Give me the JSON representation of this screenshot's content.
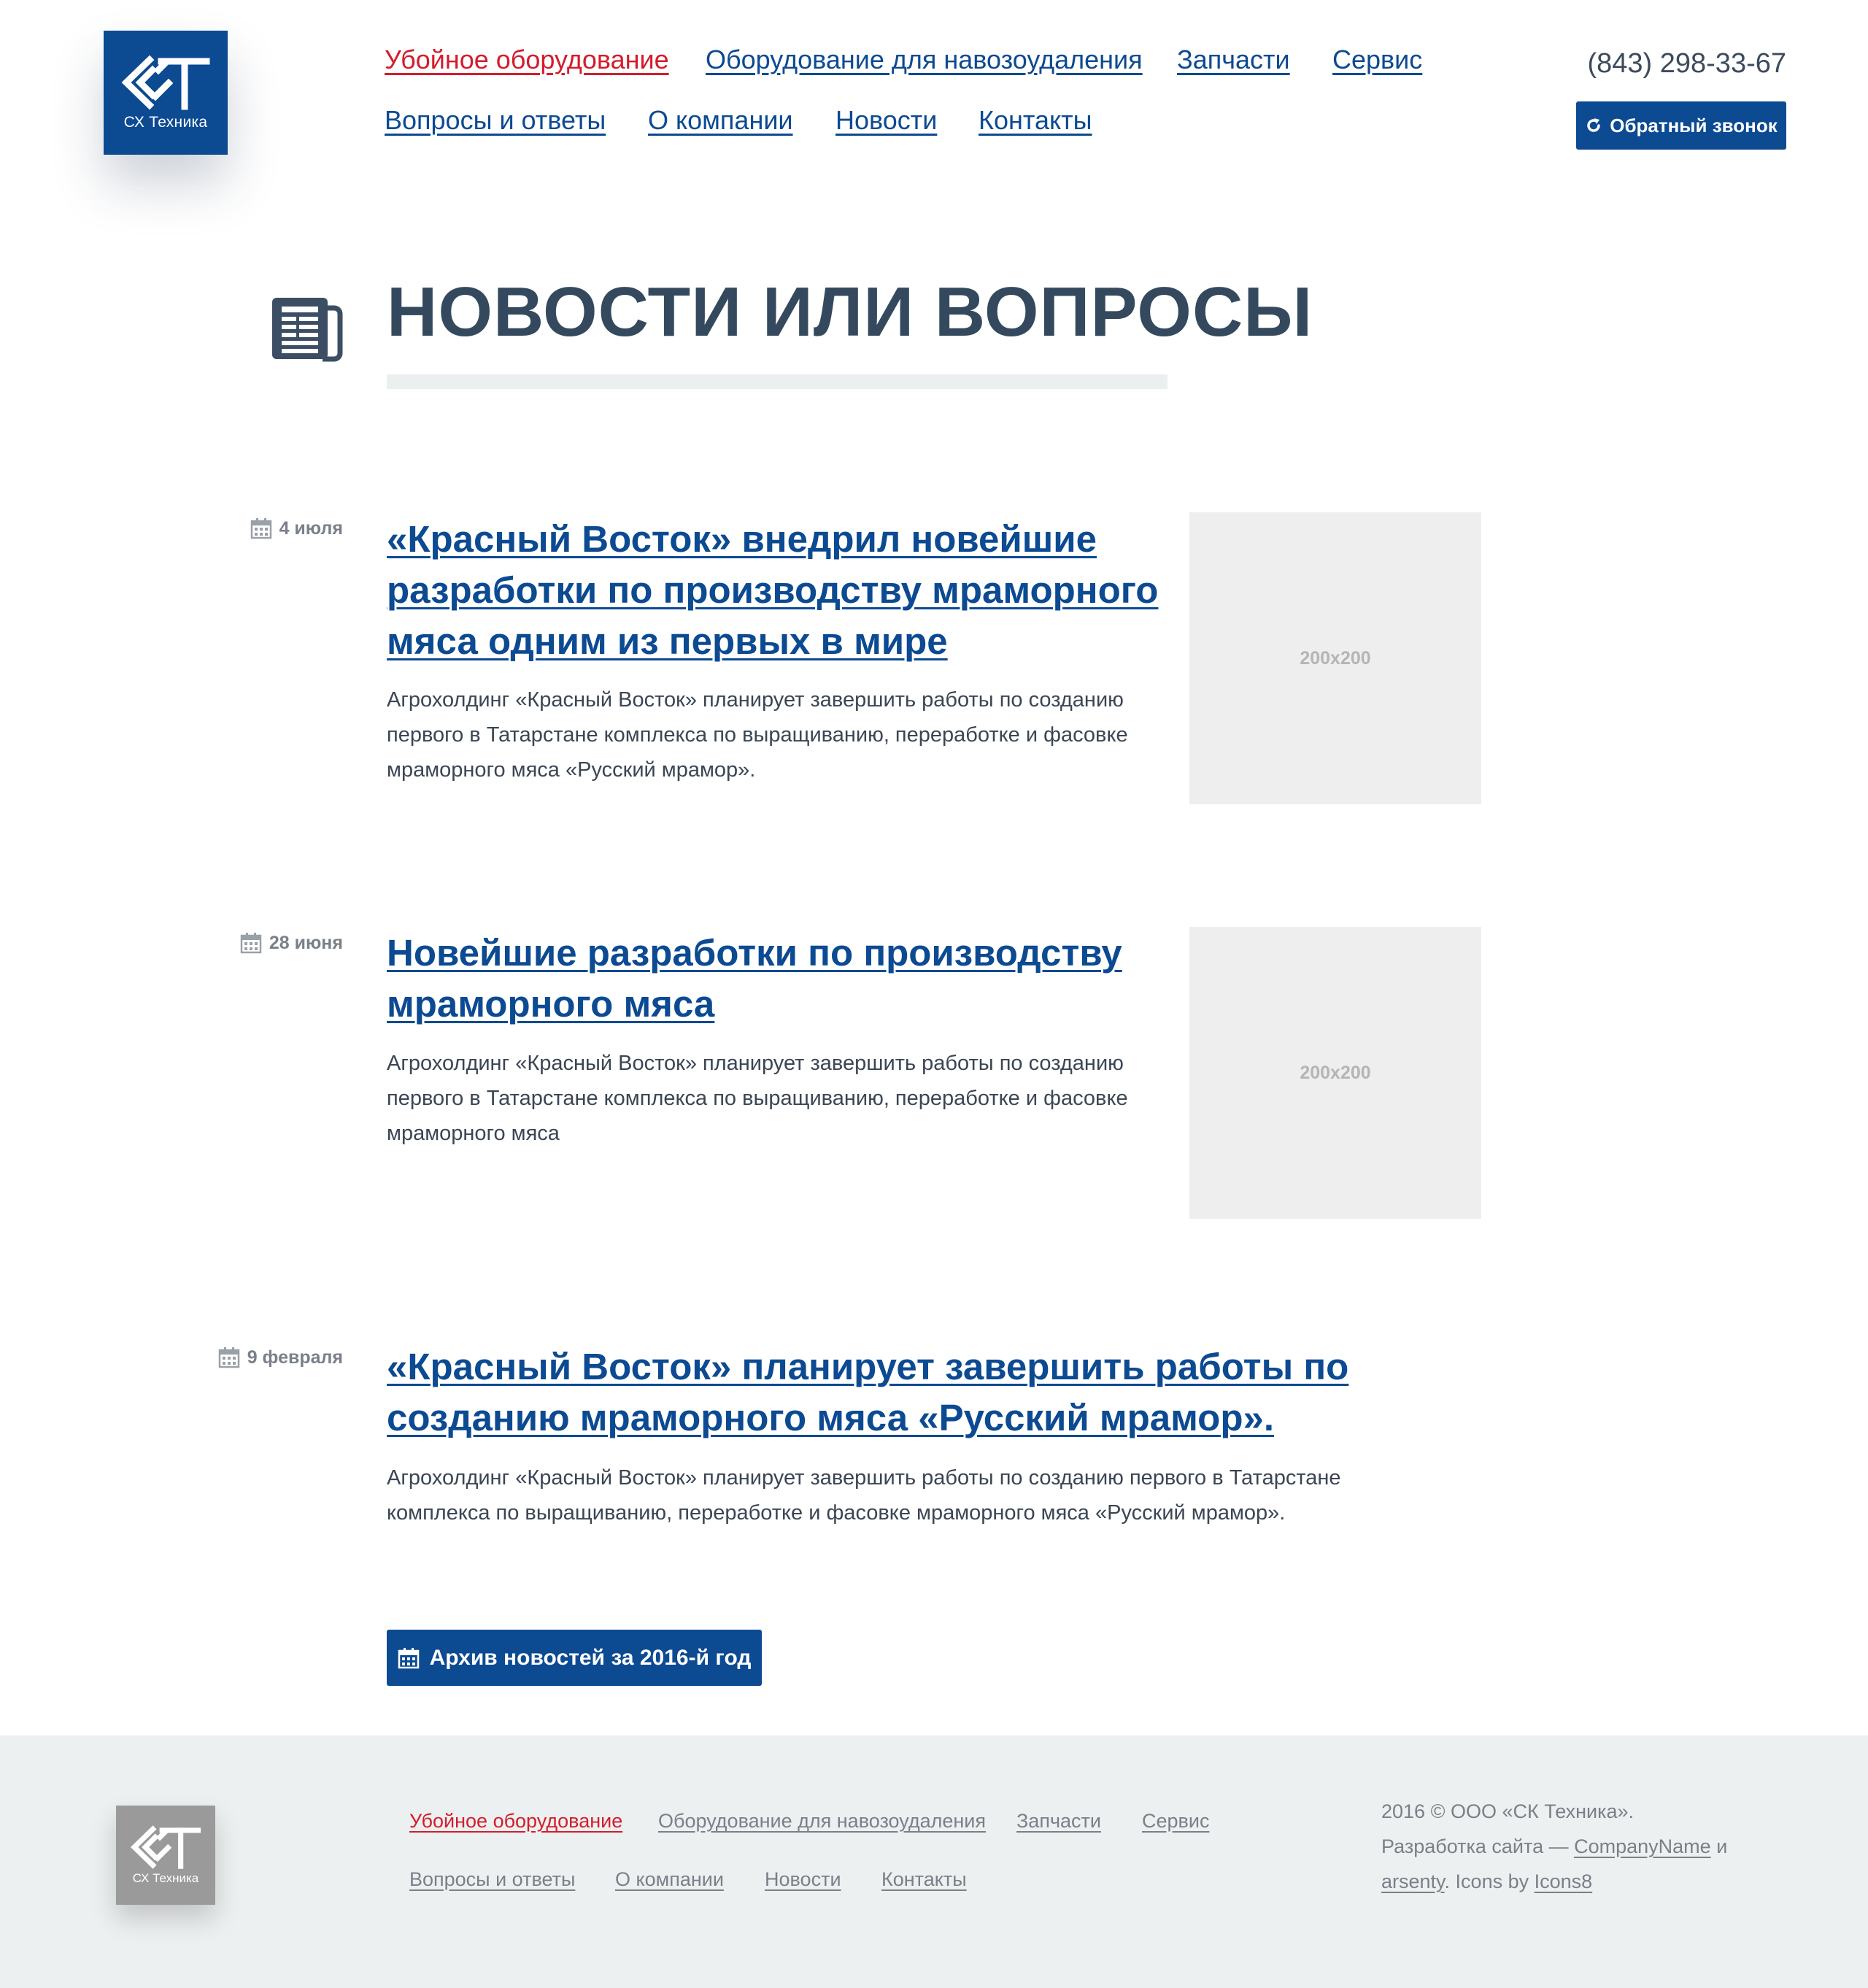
{
  "header": {
    "logo_text": "СХ Техника",
    "nav": [
      {
        "label": "Убойное оборудование",
        "active": true
      },
      {
        "label": "Оборудование для навозоудаления"
      },
      {
        "label": "Запчасти"
      },
      {
        "label": "Сервис"
      },
      {
        "label": "Вопросы и ответы"
      },
      {
        "label": "О компании"
      },
      {
        "label": "Новости"
      },
      {
        "label": "Контакты"
      }
    ],
    "phone": "(843) 298-33-67",
    "callback_label": "Обратный звонок"
  },
  "page": {
    "title": "НОВОСТИ ИЛИ ВОПРОСЫ"
  },
  "news": [
    {
      "date": "4 июля",
      "title": "«Красный Восток» внедрил новейшие разработки по производству мраморного мяса одним из первых в мире",
      "text": "Агрохолдинг «Красный Восток» планирует завершить работы по созданию первого в Татарстане комплекса по выращиванию, переработке и фасовке мраморного мяса «Русский мрамор».",
      "image_label": "200x200"
    },
    {
      "date": "28 июня",
      "title": "Новейшие разработки по производству мраморного мяса",
      "text": "Агрохолдинг «Красный Восток» планирует завершить работы по созданию первого в Татарстане комплекса по выращиванию, переработке и фасовке мраморного мяса",
      "image_label": "200x200"
    },
    {
      "date": "9 февраля",
      "title": "«Красный Восток» планирует завершить работы по созданию мраморного мяса «Русский мрамор».",
      "text": "Агрохолдинг «Красный Восток» планирует завершить работы по созданию первого в Татарстане комплекса по выращиванию, переработке и фасовке мраморного мяса «Русский мрамор»."
    }
  ],
  "archive_label": "Архив новостей за 2016-й год",
  "footer": {
    "logo_text": "СХ Техника",
    "copyright": "2016 © ООО «СК Техника».",
    "dev_prefix": "Разработка сайта —",
    "dev_company": "CompanyName",
    "dev_and": "и",
    "dev_author": "arsenty",
    "icons_prefix": ". Icons by",
    "icons_link": "Icons8"
  },
  "colors": {
    "brand_blue": "#0c4a92",
    "active_red": "#d41c2c",
    "heading": "#34495e",
    "footer_bg": "#edf0f0"
  }
}
